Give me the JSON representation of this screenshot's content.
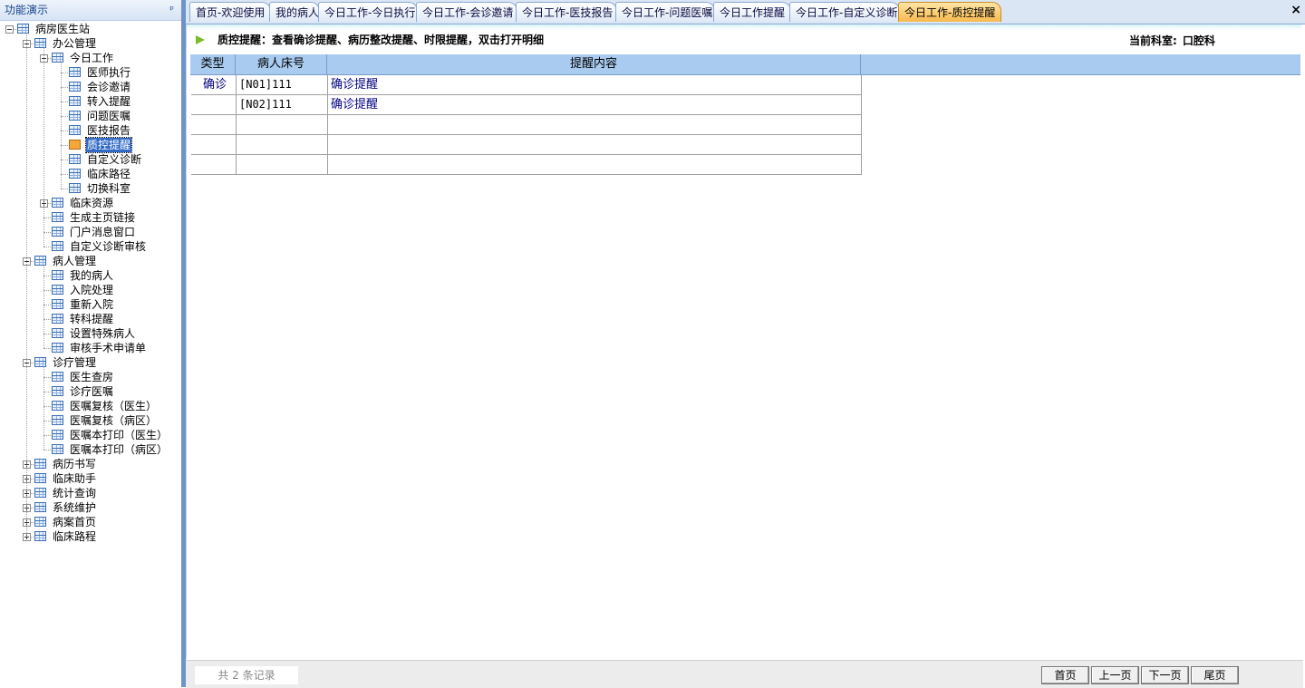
{
  "left_panel": {
    "title": "功能演示",
    "pin_icon": "pin-icon",
    "tree": [
      {
        "label": "病房医生站",
        "level": 0,
        "expander": "minus"
      },
      {
        "label": "办公管理",
        "level": 1,
        "expander": "minus"
      },
      {
        "label": "今日工作",
        "level": 2,
        "expander": "minus"
      },
      {
        "label": "医师执行",
        "level": 3
      },
      {
        "label": "会诊邀请",
        "level": 3
      },
      {
        "label": "转入提醒",
        "level": 3
      },
      {
        "label": "问题医嘱",
        "level": 3
      },
      {
        "label": "医技报告",
        "level": 3
      },
      {
        "label": "质控提醒",
        "level": 3,
        "selected": true
      },
      {
        "label": "自定义诊断",
        "level": 3
      },
      {
        "label": "临床路径",
        "level": 3
      },
      {
        "label": "切换科室",
        "level": 3
      },
      {
        "label": "临床资源",
        "level": 2,
        "expander": "plus"
      },
      {
        "label": "生成主页链接",
        "level": 2
      },
      {
        "label": "门户消息窗口",
        "level": 2
      },
      {
        "label": "自定义诊断审核",
        "level": 2
      },
      {
        "label": "病人管理",
        "level": 1,
        "expander": "minus"
      },
      {
        "label": "我的病人",
        "level": 2
      },
      {
        "label": "入院处理",
        "level": 2
      },
      {
        "label": "重新入院",
        "level": 2
      },
      {
        "label": "转科提醒",
        "level": 2
      },
      {
        "label": "设置特殊病人",
        "level": 2
      },
      {
        "label": "审核手术申请单",
        "level": 2
      },
      {
        "label": "诊疗管理",
        "level": 1,
        "expander": "minus"
      },
      {
        "label": "医生查房",
        "level": 2
      },
      {
        "label": "诊疗医嘱",
        "level": 2
      },
      {
        "label": "医嘱复核（医生）",
        "level": 2
      },
      {
        "label": "医嘱复核（病区）",
        "level": 2
      },
      {
        "label": "医嘱本打印（医生）",
        "level": 2
      },
      {
        "label": "医嘱本打印（病区）",
        "level": 2
      },
      {
        "label": "病历书写",
        "level": 1,
        "expander": "plus"
      },
      {
        "label": "临床助手",
        "level": 1,
        "expander": "plus"
      },
      {
        "label": "统计查询",
        "level": 1,
        "expander": "plus"
      },
      {
        "label": "系统维护",
        "level": 1,
        "expander": "plus"
      },
      {
        "label": "病案首页",
        "level": 1,
        "expander": "plus"
      },
      {
        "label": "临床路程",
        "level": 1,
        "expander": "plus"
      }
    ]
  },
  "tabs": [
    {
      "label": "首页-欢迎使用"
    },
    {
      "label": "我的病人"
    },
    {
      "label": "今日工作-今日执行"
    },
    {
      "label": "今日工作-会诊邀请"
    },
    {
      "label": "今日工作-医技报告"
    },
    {
      "label": "今日工作-问题医嘱"
    },
    {
      "label": "今日工作提醒"
    },
    {
      "label": "今日工作-自定义诊断"
    },
    {
      "label": "今日工作-质控提醒",
      "active": true
    }
  ],
  "close_label": "×",
  "notice": {
    "text": "质控提醒：查看确诊提醒、病历整改提醒、时限提醒，双击打开明细",
    "dept_label": "当前科室:",
    "dept_value": "口腔科"
  },
  "table": {
    "headers": [
      "类型",
      "病人床号",
      "提醒内容"
    ],
    "rows": [
      [
        "确诊",
        "[N01]111",
        "确诊提醒"
      ],
      [
        "",
        "[N02]111",
        "确诊提醒"
      ],
      [
        "",
        "",
        ""
      ],
      [
        "",
        "",
        ""
      ],
      [
        "",
        "",
        ""
      ]
    ]
  },
  "pager": {
    "records": "共 2 条记录",
    "first": "首页",
    "prev": "上一页",
    "next": "下一页",
    "last": "尾页"
  },
  "colors": {
    "selected_tab": "#f7b94c",
    "header_bg": "#a9cbef",
    "splitter": "#6e93c9",
    "tree_selected": "#316ac5"
  }
}
